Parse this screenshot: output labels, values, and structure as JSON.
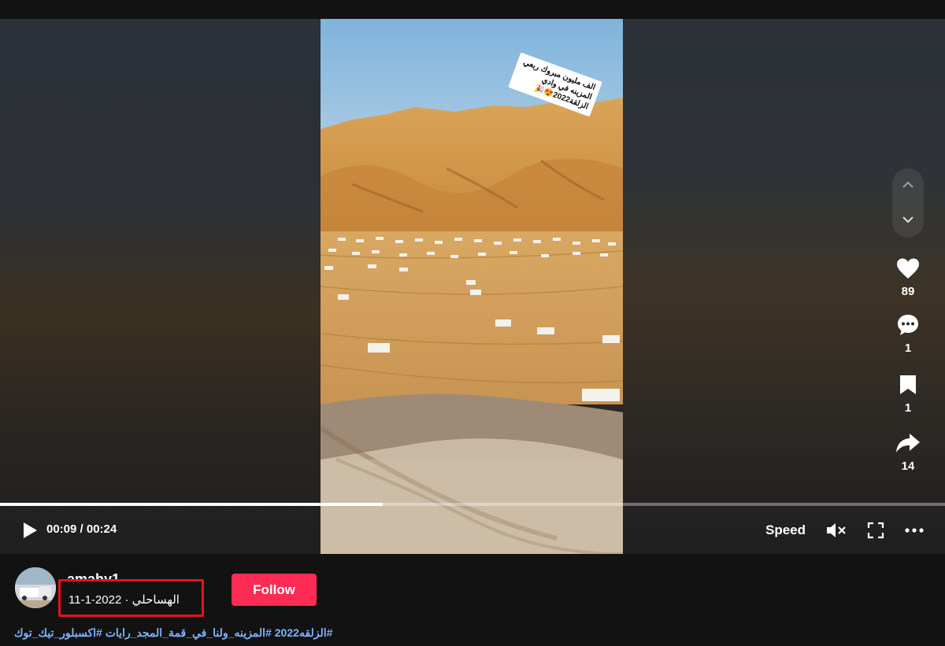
{
  "video": {
    "caption_sticker": "الف مليون مبروك ربعي المزينه في وادي الزلقة2022😍🎉"
  },
  "actions": {
    "likes": "89",
    "comments": "1",
    "bookmarks": "1",
    "shares": "14"
  },
  "playback": {
    "time": "00:09 / 00:24",
    "progress": 0.405,
    "speed_label": "Speed"
  },
  "author": {
    "username": "amahy1",
    "meta": "الهساحلي · 2022-1-11"
  },
  "follow_label": "Follow",
  "hashtags": "#الزلقه2022 #المزينه_ولنا_في_قمة_المجد_رايات #اكسبلور_تيك_توك",
  "colors": {
    "follow_bg": "#fe2c55",
    "highlight_border": "#e3141c",
    "hashtag_color": "#7fb2ff"
  }
}
